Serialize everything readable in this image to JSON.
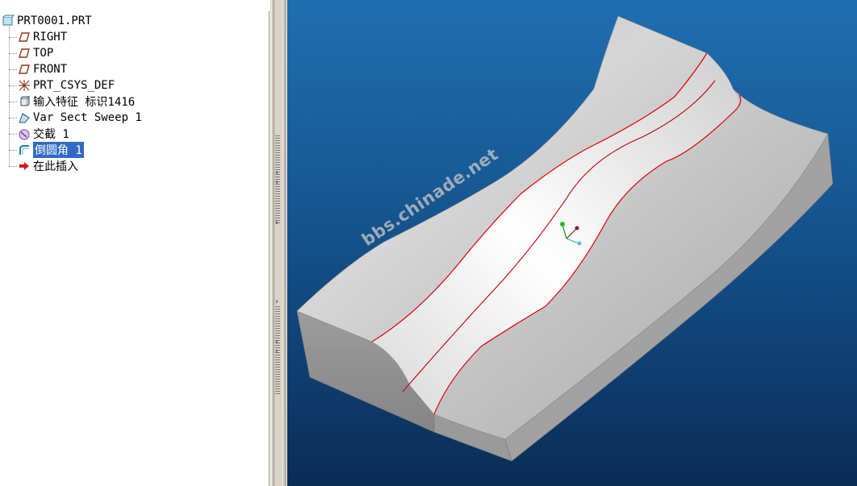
{
  "model_tree": {
    "root": {
      "label": "PRT0001.PRT",
      "icon": "part-icon"
    },
    "items": [
      {
        "label": "RIGHT",
        "icon": "datum-plane-icon",
        "selected": false
      },
      {
        "label": "TOP",
        "icon": "datum-plane-icon",
        "selected": false
      },
      {
        "label": "FRONT",
        "icon": "datum-plane-icon",
        "selected": false
      },
      {
        "label": "PRT_CSYS_DEF",
        "icon": "coordinate-system-icon",
        "selected": false
      },
      {
        "label": "输入特征 标识1416",
        "icon": "import-feature-icon",
        "selected": false
      },
      {
        "label": "Var Sect Sweep 1",
        "icon": "sweep-icon",
        "selected": false
      },
      {
        "label": "交截 1",
        "icon": "intersect-icon",
        "selected": false
      },
      {
        "label": "倒圆角 1",
        "icon": "round-icon",
        "selected": true
      },
      {
        "label": "在此插入",
        "icon": "insert-here-arrow-icon",
        "selected": false
      }
    ]
  },
  "viewport": {
    "watermark": "bbs.chinade.net",
    "colors": {
      "background_top": "#1f6fb0",
      "background_bottom": "#0a2c56",
      "edge": "#e00000",
      "selection": "#316ac5"
    }
  }
}
